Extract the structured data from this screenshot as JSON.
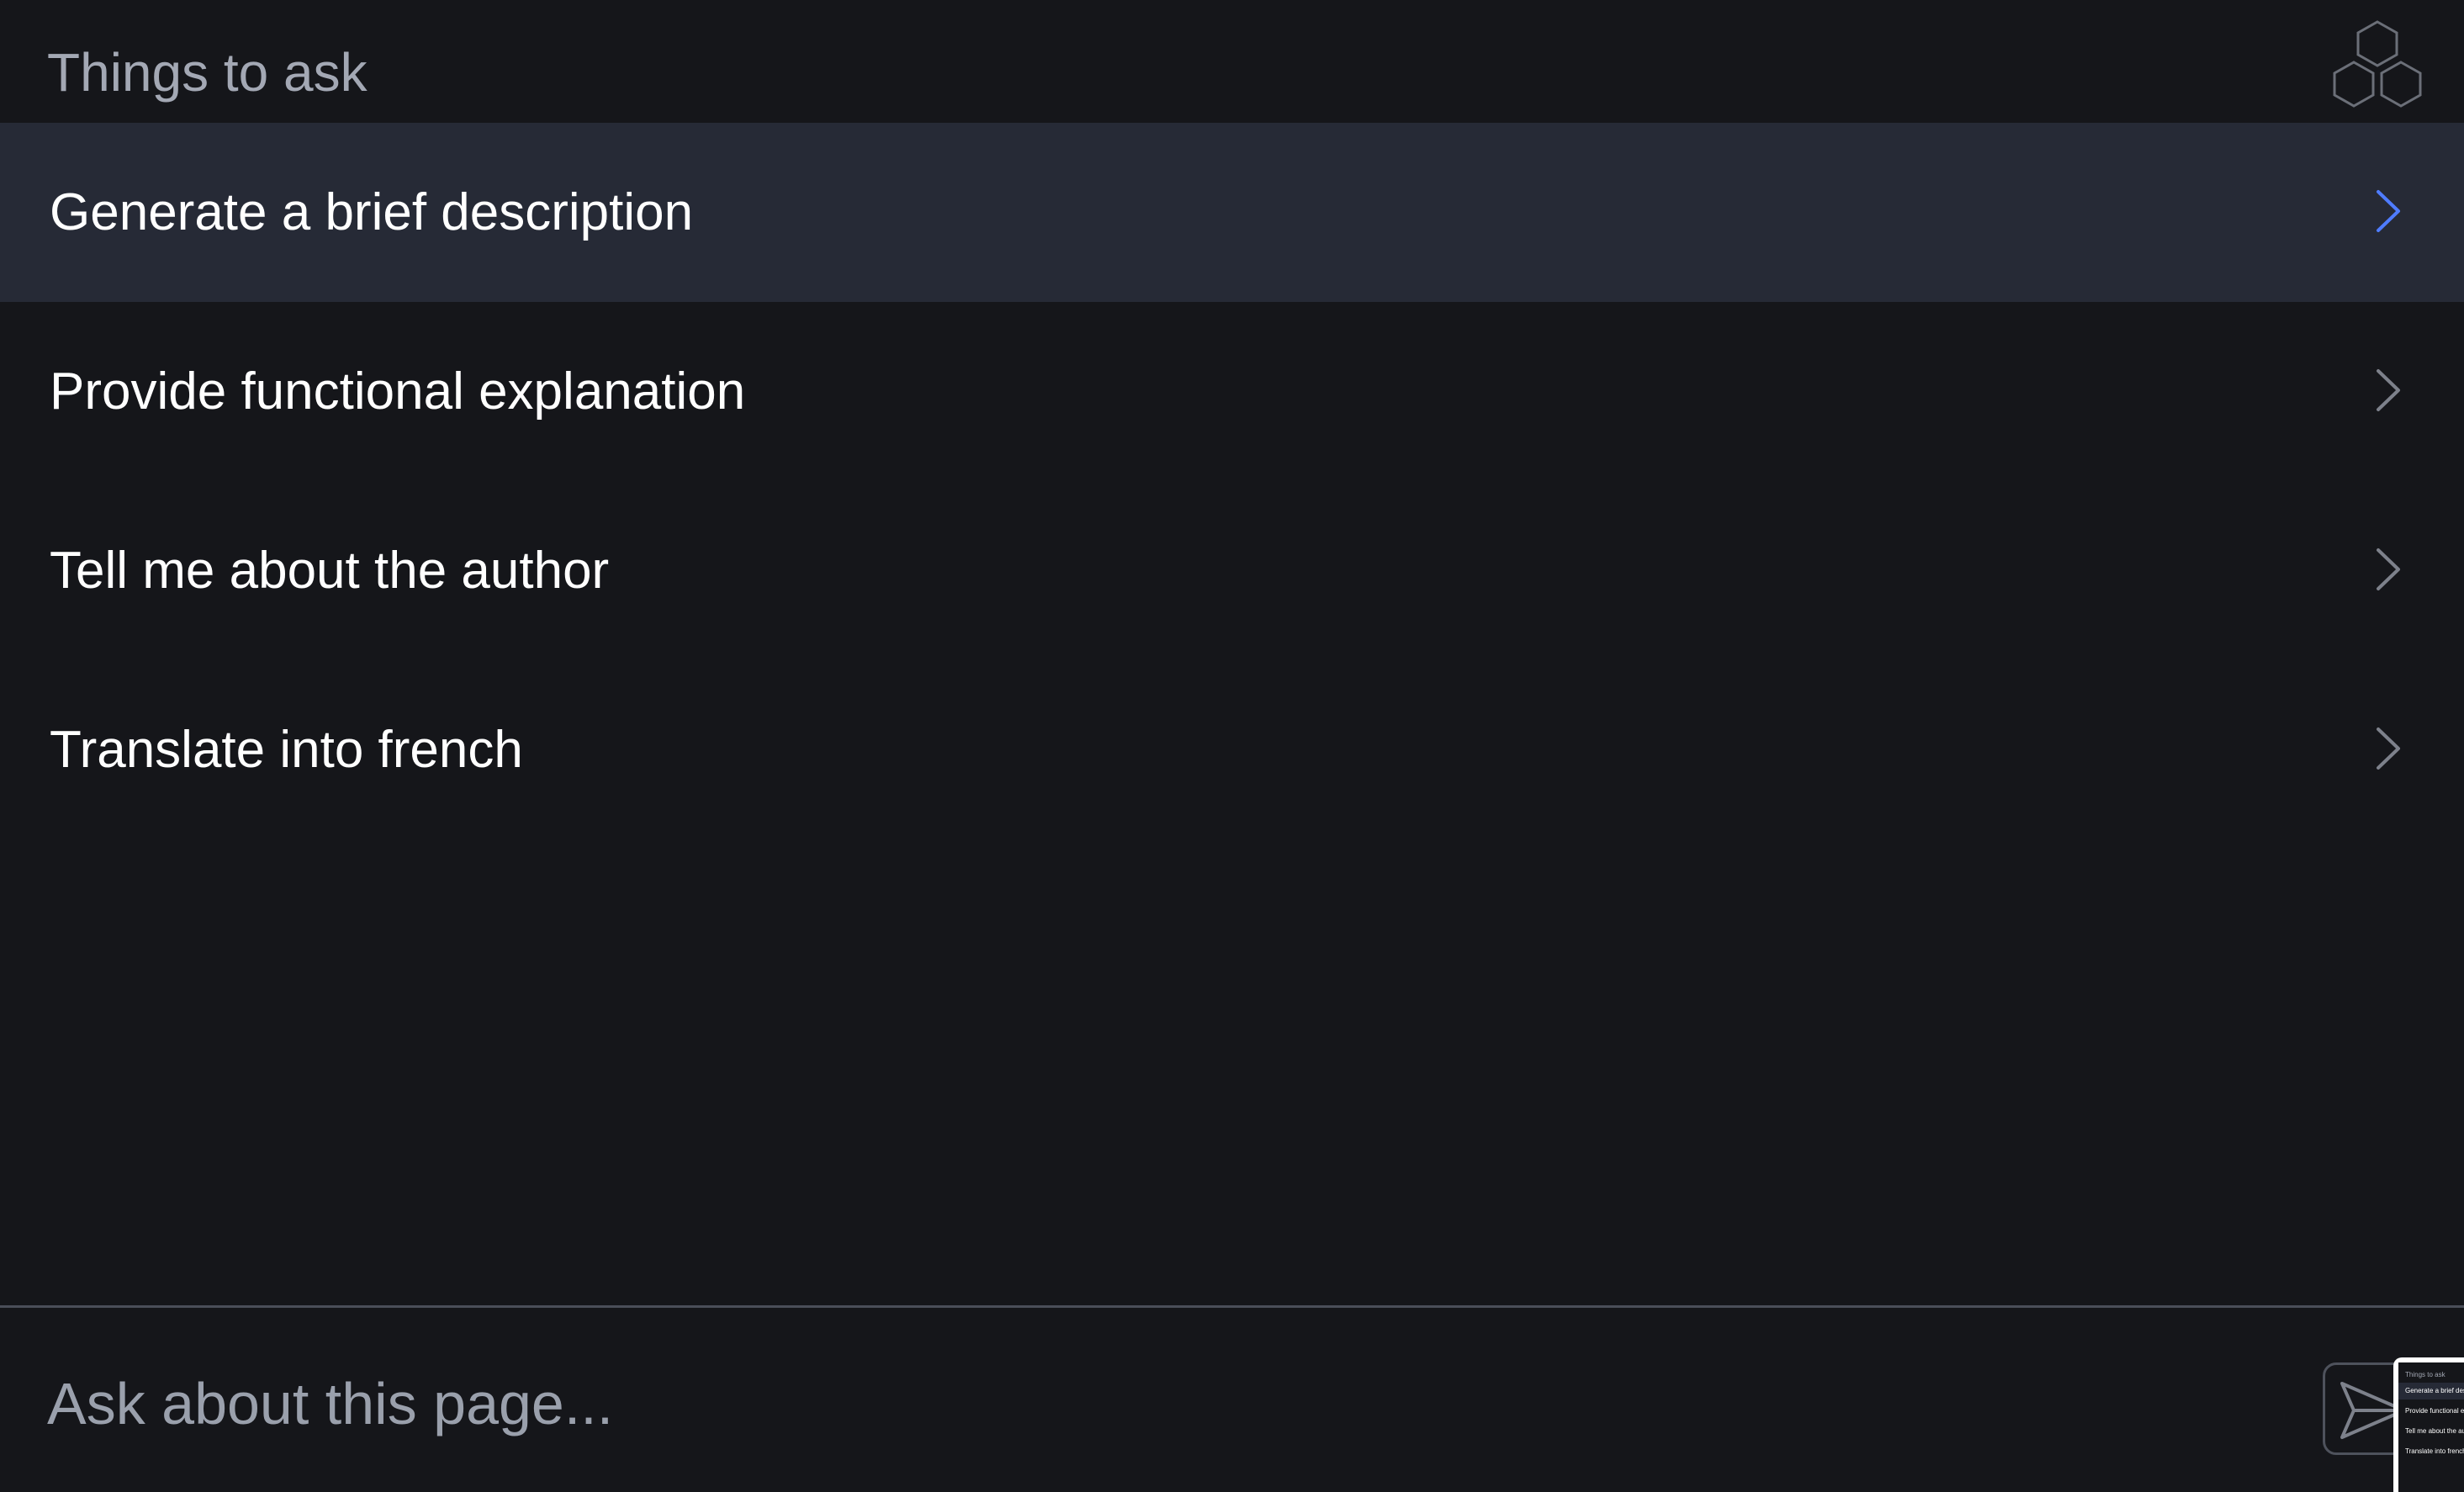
{
  "header": {
    "title": "Things to ask",
    "logo_icon": "hexagons-logo-icon"
  },
  "suggestions": [
    {
      "label": "Generate a brief description",
      "active": true
    },
    {
      "label": "Provide functional explanation",
      "active": false
    },
    {
      "label": "Tell me about the author",
      "active": false
    },
    {
      "label": "Translate into french",
      "active": false
    }
  ],
  "composer": {
    "value": "",
    "placeholder": "Ask about this page...",
    "send_icon": "send-icon"
  },
  "thumbnail": {
    "title": "Things to ask",
    "items": [
      "Generate a brief desc",
      "Provide functional exp",
      "Tell me about the auth",
      "Translate into french"
    ]
  },
  "colors": {
    "background": "#15161a",
    "active_row": "#262a36",
    "accent": "#4f7cff",
    "muted_text": "#a3a8b4",
    "chevron": "#7d818b"
  }
}
